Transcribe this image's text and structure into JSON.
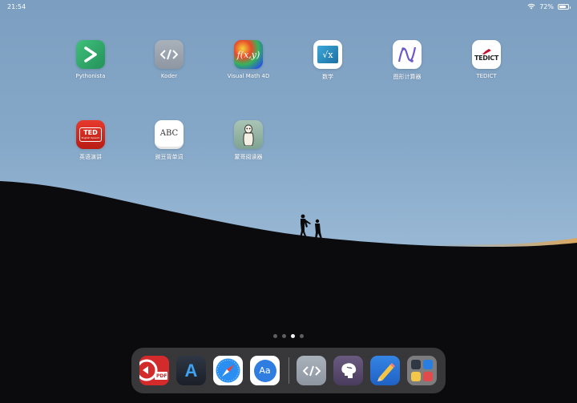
{
  "status_bar": {
    "time": "21:54",
    "battery": "72%",
    "battery_level": 0.72
  },
  "home": {
    "row1": [
      {
        "label": "Pythonista",
        "icon": "pythonista-icon"
      },
      {
        "label": "Koder",
        "icon": "koder-icon"
      },
      {
        "label": "Visual Math 4D",
        "icon": "visual-math-icon",
        "glyph": "f(x,y)"
      },
      {
        "label": "数学",
        "icon": "math-icon",
        "glyph": "√x"
      },
      {
        "label": "图形计算器",
        "icon": "graphing-calculator-icon"
      },
      {
        "label": "TEDICT",
        "icon": "tedict-icon",
        "glyph": "TEDICT"
      }
    ],
    "row2": [
      {
        "label": "英语演讲",
        "icon": "ted-english-icon",
        "glyph": "TED",
        "subglyph": "English Speech"
      },
      {
        "label": "豌豆背单词",
        "icon": "abc-vocab-icon",
        "glyph": "ABC"
      },
      {
        "label": "蒙哥阅读器",
        "icon": "meerkat-reader-icon"
      }
    ]
  },
  "page_dots": {
    "count": 4,
    "active_index": 2
  },
  "dock": {
    "apps": [
      {
        "icon": "pdf-expert-icon",
        "glyph": "PDF"
      },
      {
        "icon": "app-store-a-icon",
        "glyph": "A"
      },
      {
        "icon": "safari-icon"
      },
      {
        "icon": "dictionary-icon",
        "glyph": "Aa"
      },
      {
        "icon": "koder-icon"
      },
      {
        "icon": "brain-icon"
      },
      {
        "icon": "pencil-icon"
      },
      {
        "icon": "app-folder-icon"
      }
    ]
  },
  "colors": {
    "sky_top": "#7c9ec0",
    "sky_bottom": "#a9c6de",
    "hill": "#0b0a0c",
    "pythonista": "#2fa86a",
    "koder": "#9aa3ae",
    "tedict_red": "#c8102e",
    "ted_red": "#e62b1e",
    "dictionary": "#2f7de1",
    "brain": "#5a4a6e",
    "pencil": "#2b73d8"
  }
}
